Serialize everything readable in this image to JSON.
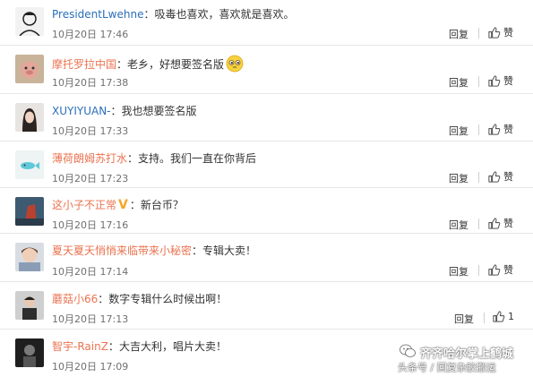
{
  "comments": [
    {
      "user": "PresidentLwehne",
      "sep": "：",
      "text": "吸毒也喜欢，喜欢就是喜欢。",
      "time": "10月20日 17:46",
      "reply": "回复",
      "like": "赞"
    },
    {
      "user": "摩托罗拉中国",
      "sep": "：",
      "text": "老乡，好想要签名版",
      "time": "10月20日 17:38",
      "reply": "回复",
      "like": "赞"
    },
    {
      "user": "XUYIYUAN-",
      "sep": "：",
      "text": "我也想要签名版",
      "time": "10月20日 17:33",
      "reply": "回复",
      "like": "赞"
    },
    {
      "user": "薄荷朗姆苏打水",
      "sep": "：",
      "text": "支持。我们一直在你背后",
      "time": "10月20日 17:23",
      "reply": "回复",
      "like": "赞"
    },
    {
      "user": "这小子不正常",
      "sep": "：",
      "text": "新台币？",
      "time": "10月20日 17:16",
      "reply": "回复",
      "like": "赞"
    },
    {
      "user": "夏天夏天悄悄来临带来小秘密",
      "sep": "：",
      "text": "专辑大卖！",
      "time": "10月20日 17:14",
      "reply": "回复",
      "like": "赞"
    },
    {
      "user": "蘑菇小66",
      "sep": "：",
      "text": "数字专辑什么时候出啊！",
      "time": "10月20日 17:13",
      "reply": "回复",
      "like": "1"
    },
    {
      "user": "智宇-RainZ",
      "sep": "：",
      "text": "大吉大利，唱片大卖！",
      "time": "10月20日 17:09",
      "reply": "",
      "like": ""
    }
  ],
  "watermark": {
    "line1": "齐齐哈尔掌上鹤城",
    "line2": "头条号 / 回复杂胶搬运"
  },
  "colors": {
    "username": "#eb7350",
    "time": "#6f6f6f",
    "badge": "#f5a623"
  },
  "icons": [
    "avatar",
    "thumbs-up-icon",
    "v-badge-icon",
    "emoji-icon",
    "wechat-icon"
  ]
}
